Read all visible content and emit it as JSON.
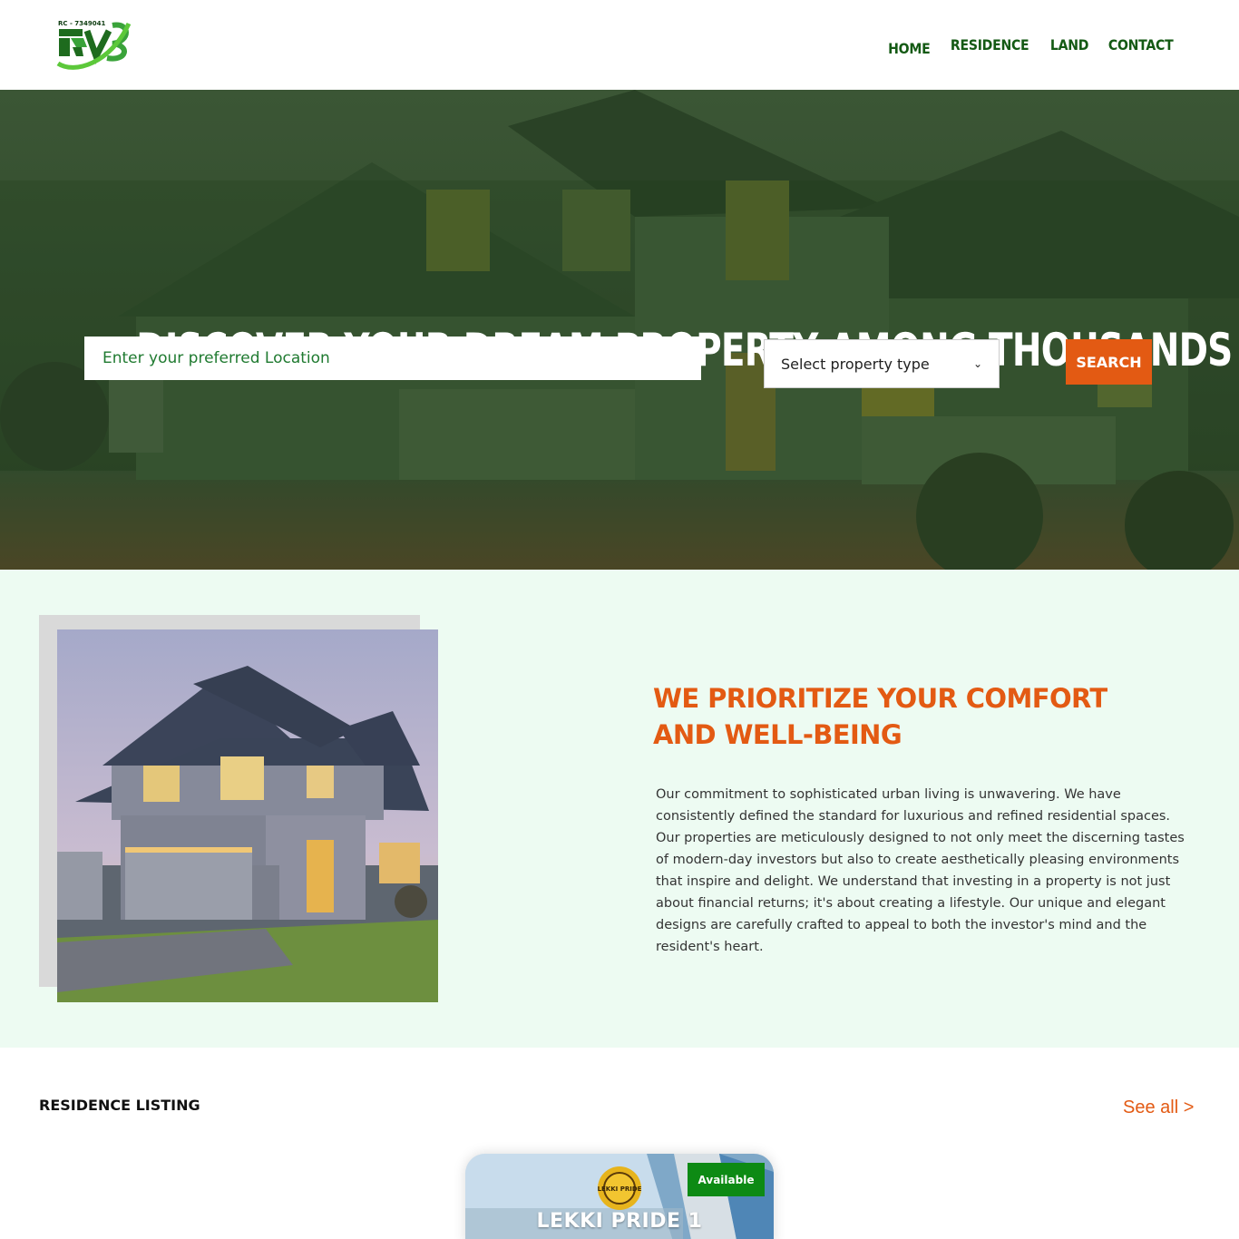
{
  "header": {
    "logo_text": "RC - 7349041",
    "nav": [
      {
        "label": "HOME"
      },
      {
        "label": "RESIDENCE"
      },
      {
        "label": "LAND"
      },
      {
        "label": "CONTACT"
      }
    ],
    "nav_color": "#145a14"
  },
  "hero": {
    "title": "DISCOVER YOUR DREAM PROPERTY AMONG THOUSANDS",
    "location_placeholder": "Enter your preferred Location",
    "property_type_selected": "Select property type",
    "search_label": "SEARCH",
    "accent": "#e35a13"
  },
  "about": {
    "title": "WE PRIORITIZE YOUR COMFORT AND WELL-BEING",
    "text": "Our commitment to sophisticated urban living is unwavering. We have consistently defined the standard for luxurious and refined residential spaces. Our properties are meticulously designed to not only meet the discerning tastes of modern-day investors but also to create aesthetically pleasing environments that inspire and delight. We understand that investing in a property is not just about financial returns; it's about creating a lifestyle. Our unique and elegant designs are carefully crafted to appeal to both the investor's mind and the resident's heart.",
    "background": "#edfbf2"
  },
  "listing": {
    "title": "RESIDENCE LISTING",
    "see_all": "See all >",
    "cards": [
      {
        "name": "LEKKI PRIDE 1",
        "status": "Available",
        "logo_text": "LEKKI PRIDE"
      }
    ]
  }
}
